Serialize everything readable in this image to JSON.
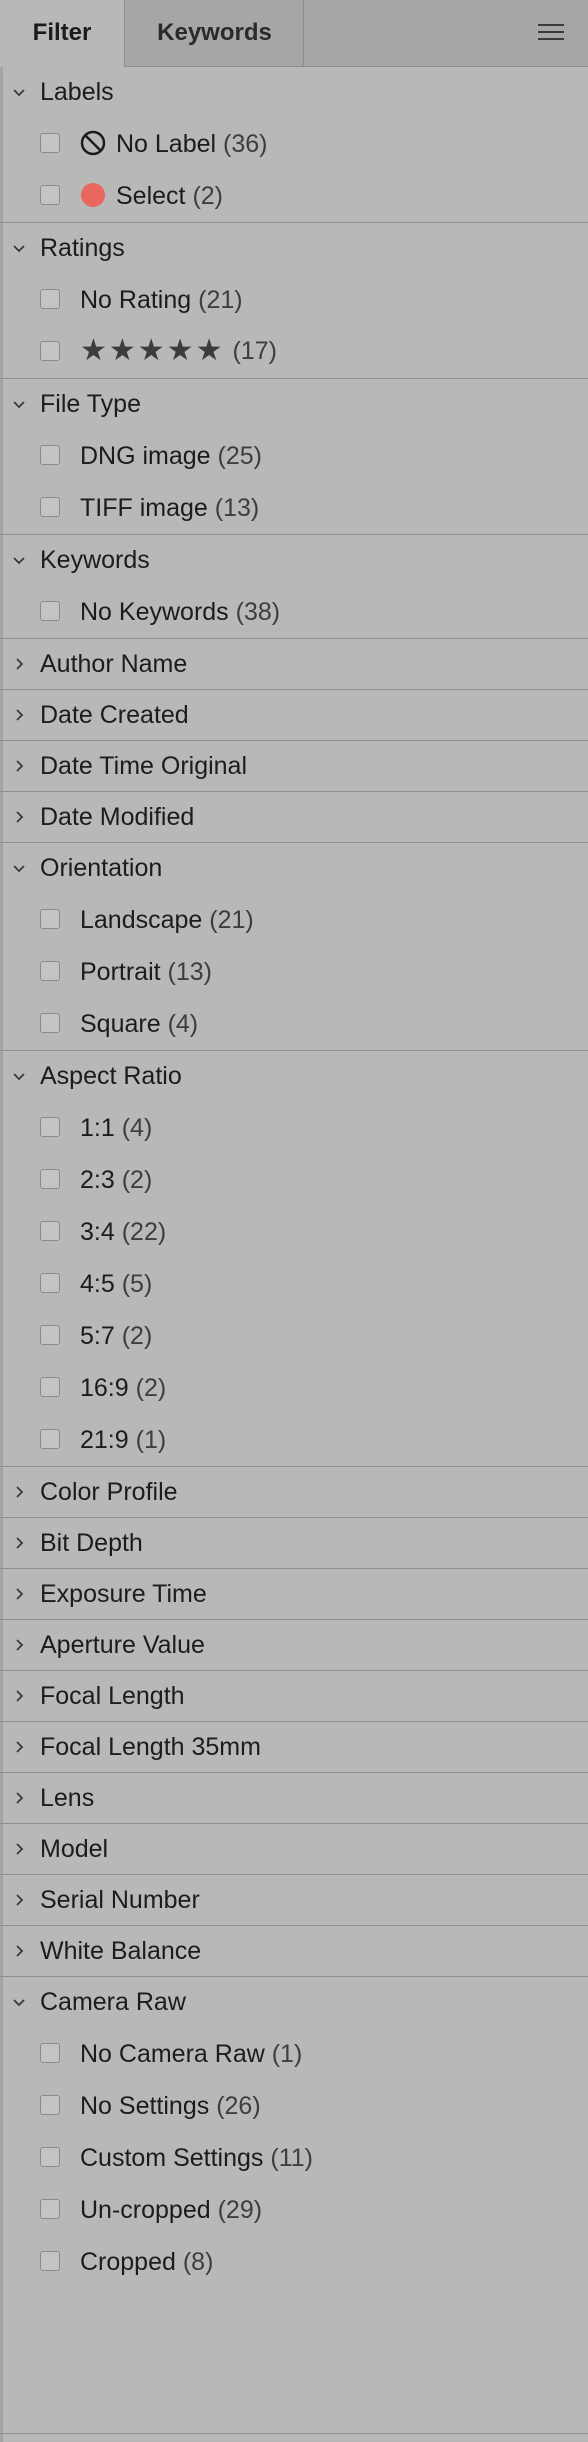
{
  "tabs": {
    "filter": "Filter",
    "keywords": "Keywords"
  },
  "menu_icon": "hamburger-menu-icon",
  "colors": {
    "panel_bg": "#b8b8b8",
    "tabbar_bg": "#a6a6a6",
    "select_label_dot": "#e8675f"
  },
  "sections": {
    "labels": {
      "title": "Labels",
      "expanded": true,
      "items": [
        {
          "label": "No Label",
          "count": "(36)",
          "icon": "no-label-icon"
        },
        {
          "label": "Select",
          "count": "(2)",
          "icon": "red-dot-icon"
        }
      ]
    },
    "ratings": {
      "title": "Ratings",
      "expanded": true,
      "items": [
        {
          "label": "No Rating",
          "count": "(21)"
        },
        {
          "label": "★★★★★",
          "count": "(17)",
          "stars": 5
        }
      ]
    },
    "file_type": {
      "title": "File Type",
      "expanded": true,
      "items": [
        {
          "label": "DNG image",
          "count": "(25)"
        },
        {
          "label": "TIFF image",
          "count": "(13)"
        }
      ]
    },
    "keywords": {
      "title": "Keywords",
      "expanded": true,
      "items": [
        {
          "label": "No Keywords",
          "count": "(38)"
        }
      ]
    },
    "author_name": {
      "title": "Author Name",
      "expanded": false
    },
    "date_created": {
      "title": "Date Created",
      "expanded": false
    },
    "date_time_original": {
      "title": "Date Time Original",
      "expanded": false
    },
    "date_modified": {
      "title": "Date Modified",
      "expanded": false
    },
    "orientation": {
      "title": "Orientation",
      "expanded": true,
      "items": [
        {
          "label": "Landscape",
          "count": "(21)"
        },
        {
          "label": "Portrait",
          "count": "(13)"
        },
        {
          "label": "Square",
          "count": "(4)"
        }
      ]
    },
    "aspect_ratio": {
      "title": "Aspect Ratio",
      "expanded": true,
      "items": [
        {
          "label": "1:1",
          "count": "(4)"
        },
        {
          "label": "2:3",
          "count": "(2)"
        },
        {
          "label": "3:4",
          "count": "(22)"
        },
        {
          "label": "4:5",
          "count": "(5)"
        },
        {
          "label": "5:7",
          "count": "(2)"
        },
        {
          "label": "16:9",
          "count": "(2)"
        },
        {
          "label": "21:9",
          "count": "(1)"
        }
      ]
    },
    "color_profile": {
      "title": "Color Profile",
      "expanded": false
    },
    "bit_depth": {
      "title": "Bit Depth",
      "expanded": false
    },
    "exposure_time": {
      "title": "Exposure Time",
      "expanded": false
    },
    "aperture_value": {
      "title": "Aperture Value",
      "expanded": false
    },
    "focal_length": {
      "title": "Focal Length",
      "expanded": false
    },
    "focal_length_35mm": {
      "title": "Focal Length 35mm",
      "expanded": false
    },
    "lens": {
      "title": "Lens",
      "expanded": false
    },
    "model": {
      "title": "Model",
      "expanded": false
    },
    "serial_number": {
      "title": "Serial Number",
      "expanded": false
    },
    "white_balance": {
      "title": "White Balance",
      "expanded": false
    },
    "camera_raw": {
      "title": "Camera Raw",
      "expanded": true,
      "items": [
        {
          "label": "No Camera Raw",
          "count": "(1)"
        },
        {
          "label": "No Settings",
          "count": "(26)"
        },
        {
          "label": "Custom Settings",
          "count": "(11)"
        },
        {
          "label": "Un-cropped",
          "count": "(29)"
        },
        {
          "label": "Cropped",
          "count": "(8)"
        }
      ]
    }
  }
}
